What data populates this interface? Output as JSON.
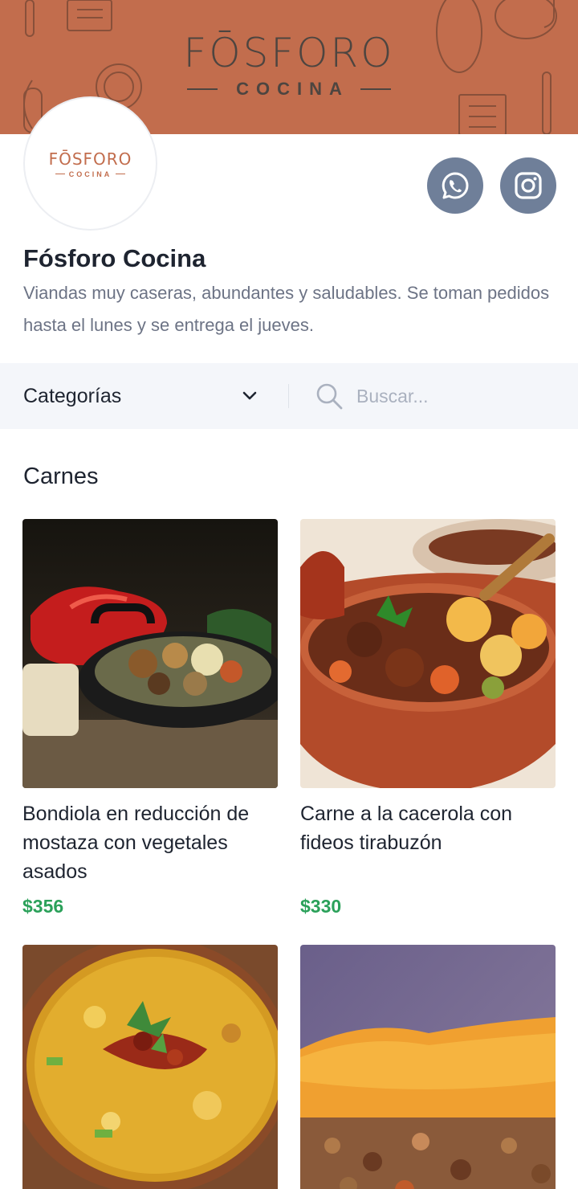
{
  "store": {
    "banner_brand": "FŌSFORO",
    "banner_sub": "COCINA",
    "avatar_brand": "FŌSFORO",
    "avatar_sub": "COCINA",
    "name": "Fósforo Cocina",
    "description": "Viandas muy caseras, abundantes y saludables. Se toman pedidos hasta el lunes y se entrega el jueves."
  },
  "social": {
    "whatsapp_icon": "whatsapp-icon",
    "instagram_icon": "instagram-icon"
  },
  "filters": {
    "category_label": "Categorías",
    "search_placeholder": "Buscar..."
  },
  "section": {
    "title": "Carnes"
  },
  "products": [
    {
      "name": "Bondiola en reducción de mostaza con vegetales asados",
      "price": "$356"
    },
    {
      "name": "Carne a la cacerola con fideos tirabuzón",
      "price": "$330"
    },
    {
      "name": "",
      "price": ""
    },
    {
      "name": "",
      "price": ""
    }
  ],
  "colors": {
    "banner": "#c26d4d",
    "social_bg": "#6f7f99",
    "price": "#2ba15a"
  }
}
